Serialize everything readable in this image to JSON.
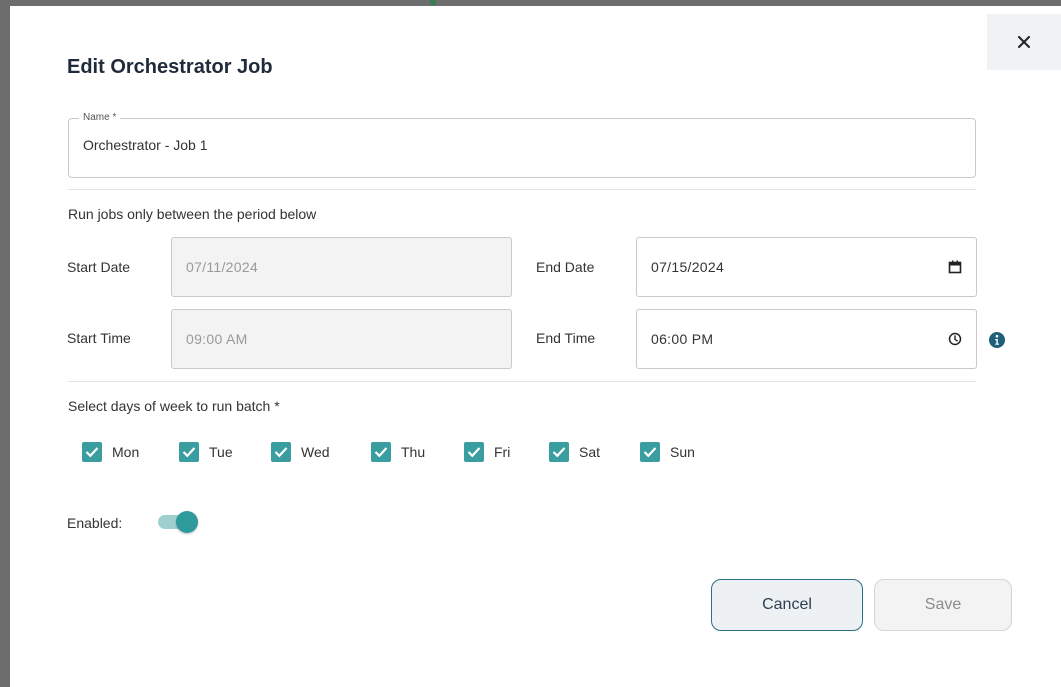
{
  "dialog": {
    "title": "Edit Orchestrator Job",
    "close_icon": "close-icon"
  },
  "name_field": {
    "label": "Name *",
    "value": "Orchestrator - Job 1"
  },
  "period": {
    "heading": "Run jobs only between the period below",
    "start_date_label": "Start Date",
    "start_date_value": "07/11/2024",
    "end_date_label": "End Date",
    "end_date_value": "07/15/2024",
    "start_time_label": "Start Time",
    "start_time_value": "09:00 AM",
    "end_time_label": "End Time",
    "end_time_value": "06:00 PM",
    "calendar_icon": "calendar-icon",
    "clock_icon": "clock-icon",
    "info_icon": "info-icon"
  },
  "days": {
    "heading": "Select days of week to run batch *",
    "items": [
      {
        "label": "Mon",
        "checked": true
      },
      {
        "label": "Tue",
        "checked": true
      },
      {
        "label": "Wed",
        "checked": true
      },
      {
        "label": "Thu",
        "checked": true
      },
      {
        "label": "Fri",
        "checked": true
      },
      {
        "label": "Sat",
        "checked": true
      },
      {
        "label": "Sun",
        "checked": true
      }
    ]
  },
  "enabled": {
    "label": "Enabled:",
    "on": true
  },
  "actions": {
    "cancel_label": "Cancel",
    "save_label": "Save"
  },
  "colors": {
    "accent": "#3a9da0",
    "title": "#1f2a3a",
    "info": "#1f5f7a"
  }
}
